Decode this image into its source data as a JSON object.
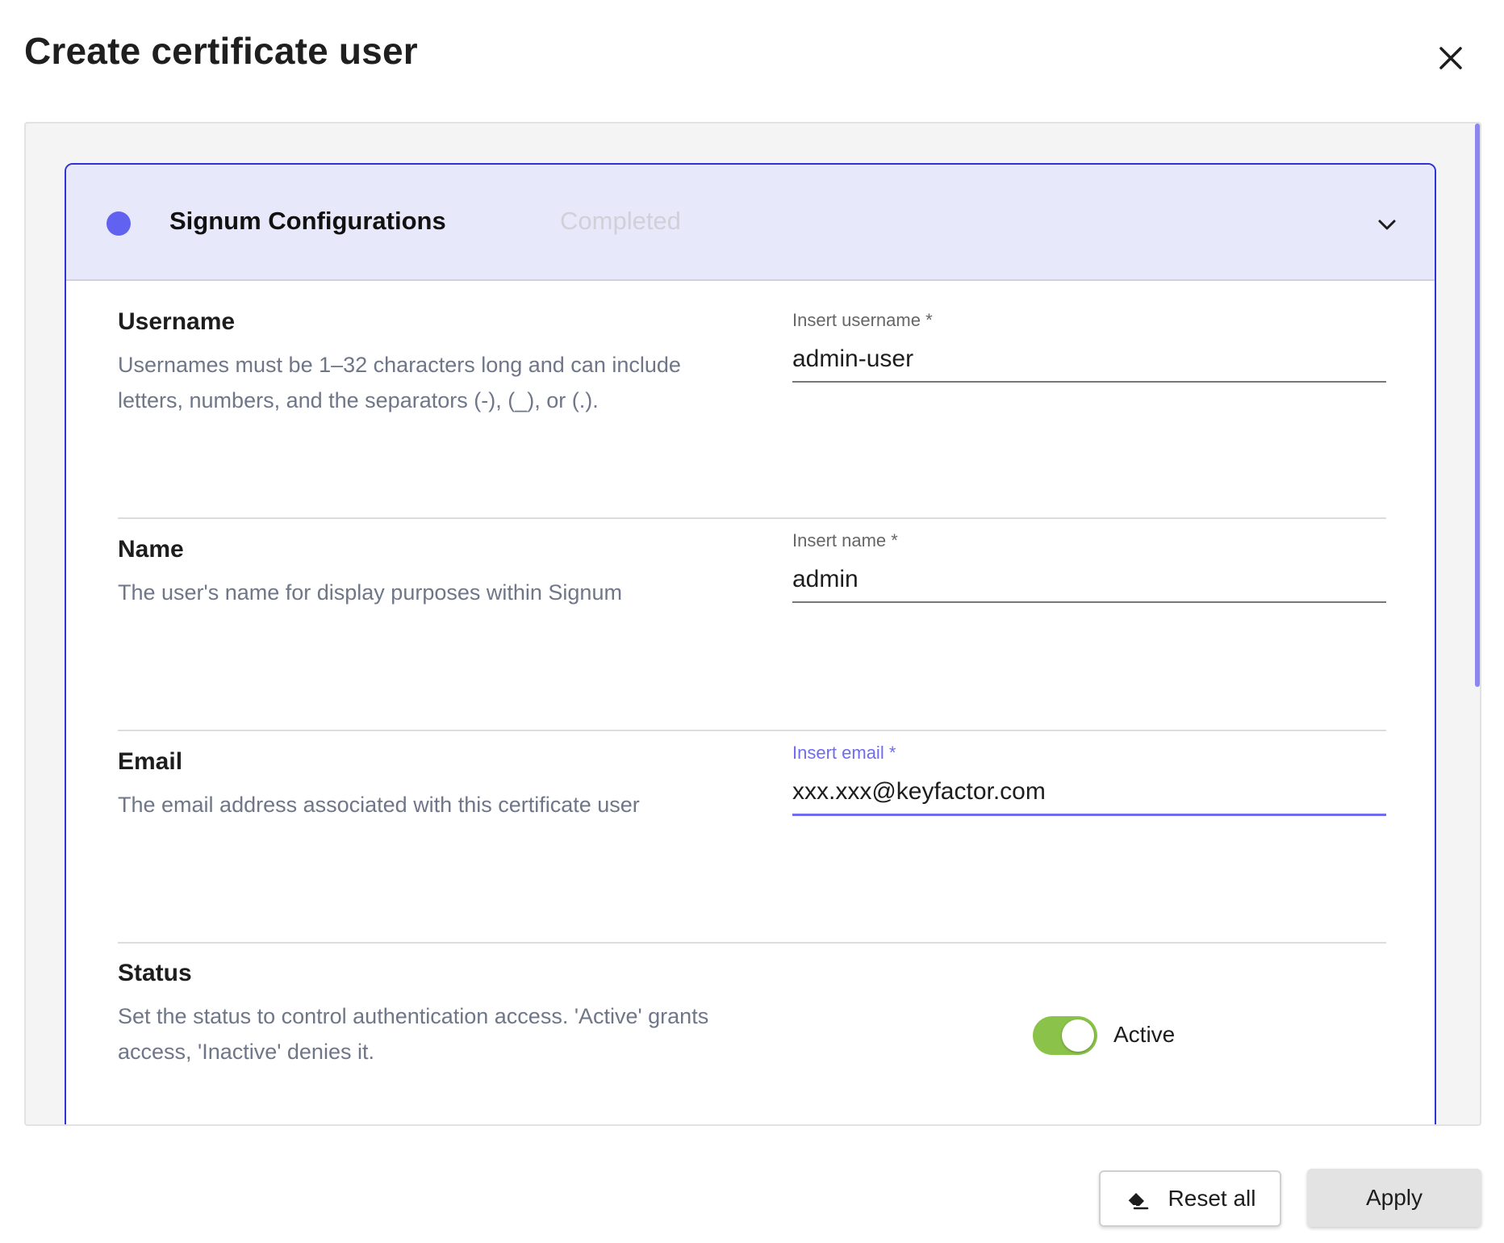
{
  "dialog": {
    "title": "Create certificate user",
    "close_icon": "close-icon"
  },
  "section": {
    "title": "Signum Configurations",
    "status": "Completed",
    "indicator_color": "#6262f0",
    "toggle_icon": "chevron-down-icon"
  },
  "fields": {
    "username": {
      "label": "Username",
      "description": "Usernames must be 1–32 characters long and can include letters, numbers, and the separators (-), (_), or (.).",
      "input_label": "Insert username *",
      "value": "admin-user"
    },
    "name": {
      "label": "Name",
      "description": "The user's name for display purposes within Signum",
      "input_label": "Insert name *",
      "value": "admin"
    },
    "email": {
      "label": "Email",
      "description": "The email address associated with this certificate user",
      "input_label": "Insert email *",
      "value": "xxx.xxx@keyfactor.com"
    },
    "status": {
      "label": "Status",
      "description": "Set the status to control authentication access. 'Active' grants access, 'Inactive' denies it.",
      "toggle_state": "Active",
      "toggle_on": true,
      "toggle_color": "#8bc34a"
    }
  },
  "footer": {
    "reset_label": "Reset all",
    "reset_icon": "eraser-icon",
    "apply_label": "Apply"
  },
  "colors": {
    "accent": "#6f6cf0",
    "panel_border": "#3034d6",
    "header_bg": "#e8e8fb"
  }
}
